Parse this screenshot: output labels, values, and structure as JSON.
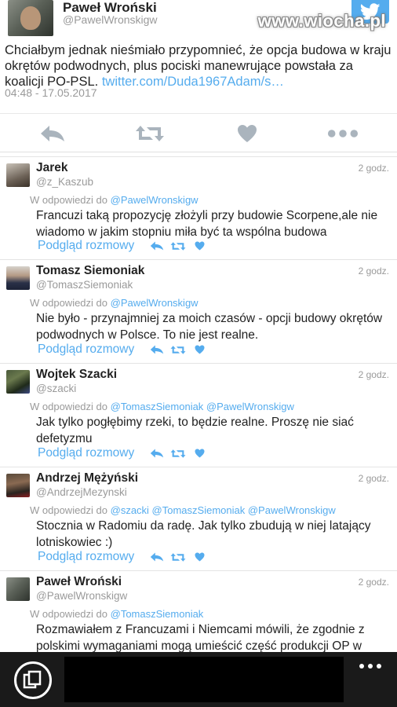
{
  "main_tweet": {
    "author_name": "Paweł Wroński",
    "author_handle": "@PawelWronskigw",
    "watermark": "www.wiocha.pl",
    "text": "Chciałbym jednak nieśmiało przypomnieć, że opcja budowa w kraju okrętów podwodnych, plus pociski manewrujące powstała za koalicji PO-PSL.",
    "link": "twitter.com/Duda1967Adam/s…",
    "timestamp": "04:48 - 17.05.2017",
    "actions": [
      "reply-icon",
      "retweet-icon",
      "like-icon",
      "more-icon"
    ]
  },
  "replies": [
    {
      "name": "Jarek",
      "handle": "@z_Kaszub",
      "time": "2 godz.",
      "in_reply_prefix": "W odpowiedzi do",
      "mentions": "@PawelWronskigw",
      "text": "Francuzi taką propozycję złożyli przy budowie Scorpene,ale nie wiadomo w jakim stopniu miła być ta wspólna budowa",
      "conversation_label": "Podgląd rozmowy"
    },
    {
      "name": "Tomasz Siemoniak",
      "handle": "@TomaszSiemoniak",
      "time": "2 godz.",
      "in_reply_prefix": "W odpowiedzi do",
      "mentions": "@PawelWronskigw",
      "text": "Nie było - przynajmniej za moich czasów - opcji budowy okrętów podwodnych w Polsce. To nie jest realne.",
      "conversation_label": "Podgląd rozmowy"
    },
    {
      "name": "Wojtek Szacki",
      "handle": "@szacki",
      "time": "2 godz.",
      "in_reply_prefix": "W odpowiedzi do",
      "mentions": "@TomaszSiemoniak @PawelWronskigw",
      "text": "Jak tylko pogłębimy rzeki, to będzie realne. Proszę nie siać defetyzmu",
      "conversation_label": "Podgląd rozmowy"
    },
    {
      "name": "Andrzej Mężyński",
      "handle": "@AndrzejMezynski",
      "time": "2 godz.",
      "in_reply_prefix": "W odpowiedzi do",
      "mentions": "@szacki @TomaszSiemoniak @PawelWronskigw",
      "text": "Stocznia w Radomiu da radę. Jak tylko zbudują w niej latający lotniskowiec :)",
      "conversation_label": "Podgląd rozmowy"
    },
    {
      "name": "Paweł Wroński",
      "handle": "@PawelWronskigw",
      "time": "2 godz.",
      "in_reply_prefix": "W odpowiedzi do",
      "mentions": "@TomaszSiemoniak",
      "text": "Rozmawiałem z Francuzami i Niemcami mówili, że zgodnie z polskimi wymaganiami mogą umieścić część produkcji OP w",
      "conversation_label": ""
    }
  ],
  "colors": {
    "accent": "#55acee",
    "muted": "#9a9a9a",
    "bottom_bar": "#1a1a1a"
  }
}
